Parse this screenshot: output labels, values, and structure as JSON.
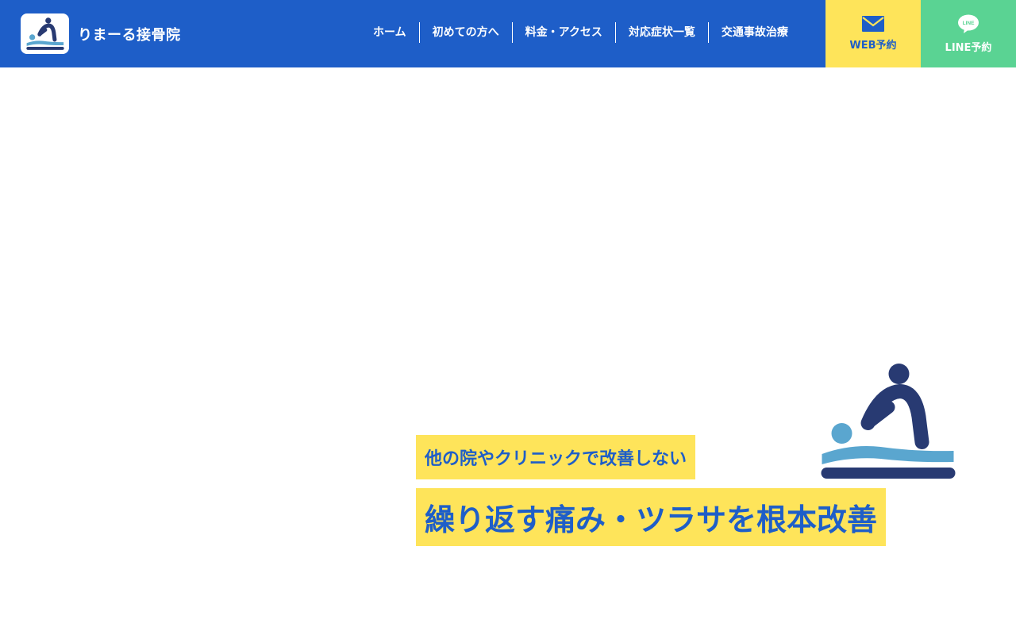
{
  "brand": {
    "name": "りまーる接骨院",
    "logo_icon": "massage-therapist-icon"
  },
  "nav": {
    "items": [
      {
        "label": "ホーム"
      },
      {
        "label": "初めての方へ"
      },
      {
        "label": "料金・アクセス"
      },
      {
        "label": "対応症状一覧"
      },
      {
        "label": "交通事故治療"
      }
    ]
  },
  "cta": {
    "web": {
      "label": "WEB予約",
      "icon": "envelope-icon"
    },
    "line": {
      "label": "LINE予約",
      "icon": "line-chat-icon",
      "icon_text": "LINE"
    }
  },
  "hero": {
    "subtitle": "他の院やクリニックで改善しない",
    "title": "繰り返す痛み・ツラサを根本改善",
    "illustration": "massage-therapist-icon"
  },
  "colors": {
    "primary": "#1e5ec8",
    "accent_yellow": "#fee45a",
    "line_green": "#5ad393",
    "figure_navy": "#283a72",
    "figure_lightblue": "#5aa6cf"
  }
}
